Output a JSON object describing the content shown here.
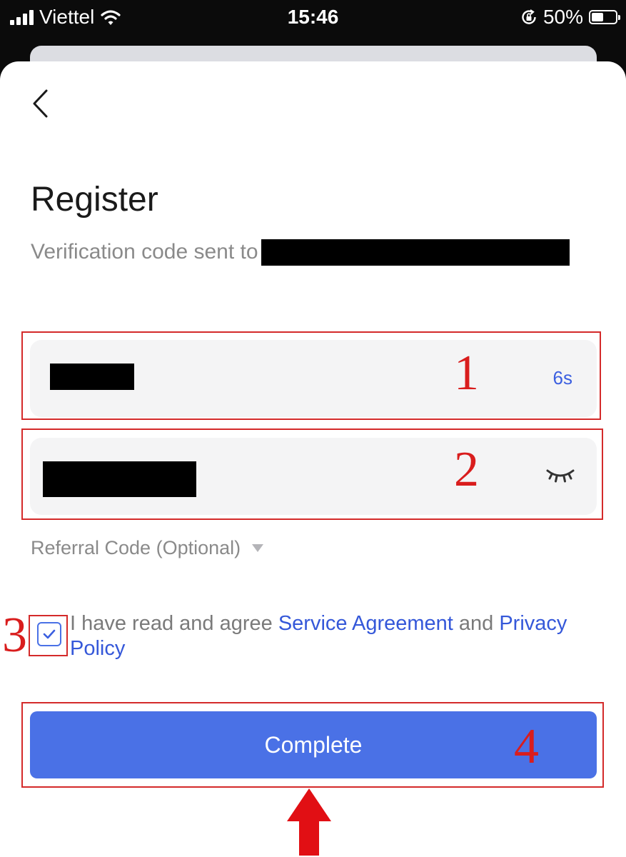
{
  "status_bar": {
    "carrier": "Viettel",
    "time": "15:46",
    "battery": "50%",
    "battery_level": 0.5
  },
  "page": {
    "title": "Register",
    "subtitle": "Verification code sent to"
  },
  "verification_field": {
    "countdown": "6s"
  },
  "password_field": {
    "toggle_icon": "eye-closed-icon"
  },
  "referral": {
    "label": "Referral Code (Optional)"
  },
  "agreement": {
    "checked": true,
    "text_before": "I have read and agree ",
    "service_link": "Service Agreement",
    "text_middle": " and ",
    "privacy_link": "Privacy Policy"
  },
  "complete_button": {
    "label": "Complete"
  },
  "annotations": {
    "step1": "1",
    "step2": "2",
    "step3": "3",
    "step4": "4",
    "color": "#d91d1d"
  },
  "colors": {
    "accent": "#4a71e6",
    "link": "#3558d9",
    "annotation": "#d91d1d"
  }
}
